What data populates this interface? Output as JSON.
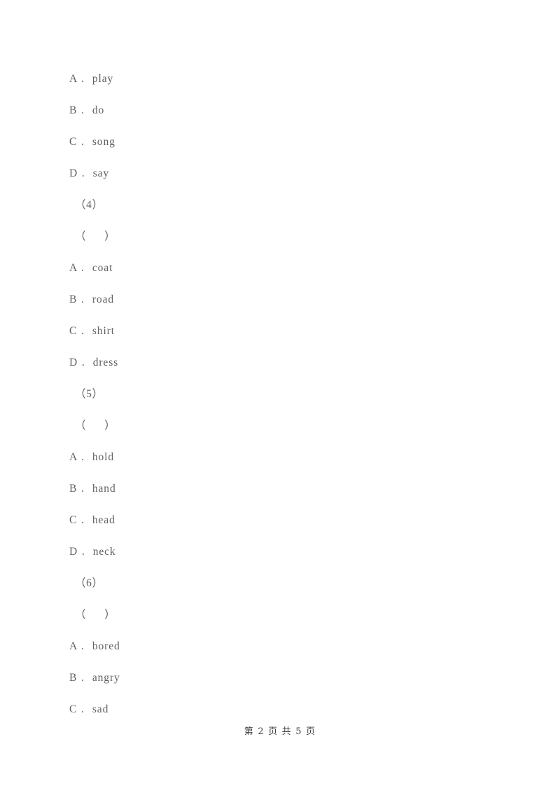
{
  "document": {
    "page_number": "2",
    "total_pages": "5",
    "footer_text": "第 2 页 共 5 页"
  },
  "blocks": [
    {
      "kind": "option",
      "letter": "A",
      "separator": ".",
      "text": "play"
    },
    {
      "kind": "option",
      "letter": "B",
      "separator": ".",
      "text": "do"
    },
    {
      "kind": "option",
      "letter": "C",
      "separator": ".",
      "text": "song"
    },
    {
      "kind": "option",
      "letter": "D",
      "separator": ".",
      "text": "say"
    },
    {
      "kind": "question-number",
      "text": "（4）"
    },
    {
      "kind": "answer-blank",
      "open": "（",
      "close": "）"
    },
    {
      "kind": "option",
      "letter": "A",
      "separator": ".",
      "text": "coat"
    },
    {
      "kind": "option",
      "letter": "B",
      "separator": ".",
      "text": "road"
    },
    {
      "kind": "option",
      "letter": "C",
      "separator": ".",
      "text": "shirt"
    },
    {
      "kind": "option",
      "letter": "D",
      "separator": ".",
      "text": "dress"
    },
    {
      "kind": "question-number",
      "text": "（5）"
    },
    {
      "kind": "answer-blank",
      "open": "（",
      "close": "）"
    },
    {
      "kind": "option",
      "letter": "A",
      "separator": ".",
      "text": "hold"
    },
    {
      "kind": "option",
      "letter": "B",
      "separator": ".",
      "text": "hand"
    },
    {
      "kind": "option",
      "letter": "C",
      "separator": ".",
      "text": "head"
    },
    {
      "kind": "option",
      "letter": "D",
      "separator": ".",
      "text": "neck"
    },
    {
      "kind": "question-number",
      "text": "（6）"
    },
    {
      "kind": "answer-blank",
      "open": "（",
      "close": "）"
    },
    {
      "kind": "option",
      "letter": "A",
      "separator": ".",
      "text": "bored"
    },
    {
      "kind": "option",
      "letter": "B",
      "separator": ".",
      "text": "angry"
    },
    {
      "kind": "option",
      "letter": "C",
      "separator": ".",
      "text": "sad"
    }
  ]
}
